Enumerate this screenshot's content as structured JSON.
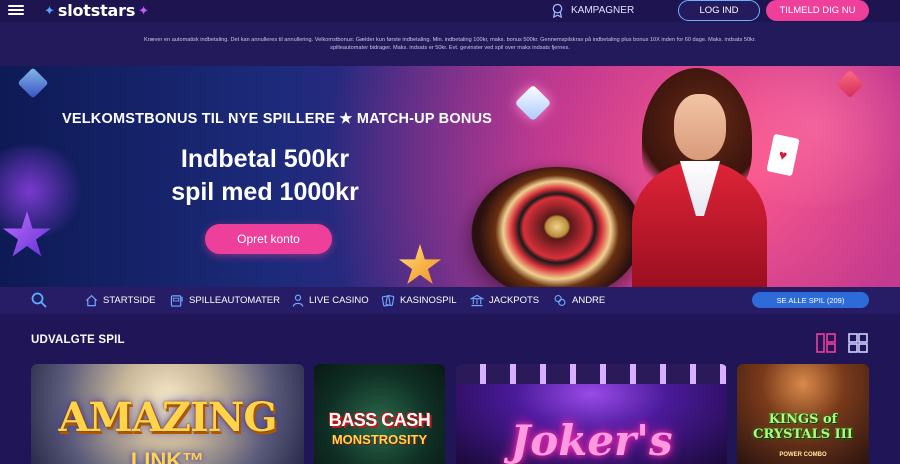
{
  "header": {
    "logo_text": "slotstars",
    "campaigns_label": "KAMPAGNER",
    "login_label": "LOG IND",
    "signup_label": "TILMELD DIG NU"
  },
  "terms": {
    "line1": "Kræver en automatisk indbetaling. Det kan annulleres til annullering. Velkomstbonus: Gælder kun første indbetaling. Min. indbetaling 100kr, maks. bonus 500kr. Gennemspilskrav på indbetaling plus bonus 10X inden for 60 dage. Maks. indsats 50kr.",
    "line2": "spilleautomater bidrager. Maks. indsats er 50kr. Evt. gevinster ved spil over maks indsats fjernes."
  },
  "hero": {
    "subtitle": "VELKOMSTBONUS TIL NYE SPILLERE ★ MATCH-UP BONUS",
    "headline_line1": "Indbetal 500kr",
    "headline_line2": "spil med 1000kr",
    "cta_label": "Opret konto"
  },
  "nav": {
    "items": [
      {
        "label": "STARTSIDE",
        "icon": "home-icon"
      },
      {
        "label": "SPILLEAUTOMATER",
        "icon": "slot-machine-icon"
      },
      {
        "label": "LIVE CASINO",
        "icon": "person-icon"
      },
      {
        "label": "KASINOSPIL",
        "icon": "cards-icon"
      },
      {
        "label": "JACKPOTS",
        "icon": "bank-icon"
      },
      {
        "label": "ANDRE",
        "icon": "puzzle-icon"
      }
    ],
    "see_all_label": "SE ALLE SPIL (209)"
  },
  "featured": {
    "title": "UDVALGTE SPIL",
    "games": [
      {
        "title": "AMAZING",
        "subtitle": "LINK™"
      },
      {
        "title": "BASS CASH",
        "subtitle": "MONSTROSITY"
      },
      {
        "title": "Joker's",
        "subtitle": ""
      },
      {
        "title": "KINGS of CRYSTALS III",
        "subtitle": "POWER COMBO"
      }
    ]
  },
  "colors": {
    "accent_pink": "#ee3f9a",
    "accent_blue": "#2d6cd8",
    "background": "#1f1557"
  }
}
